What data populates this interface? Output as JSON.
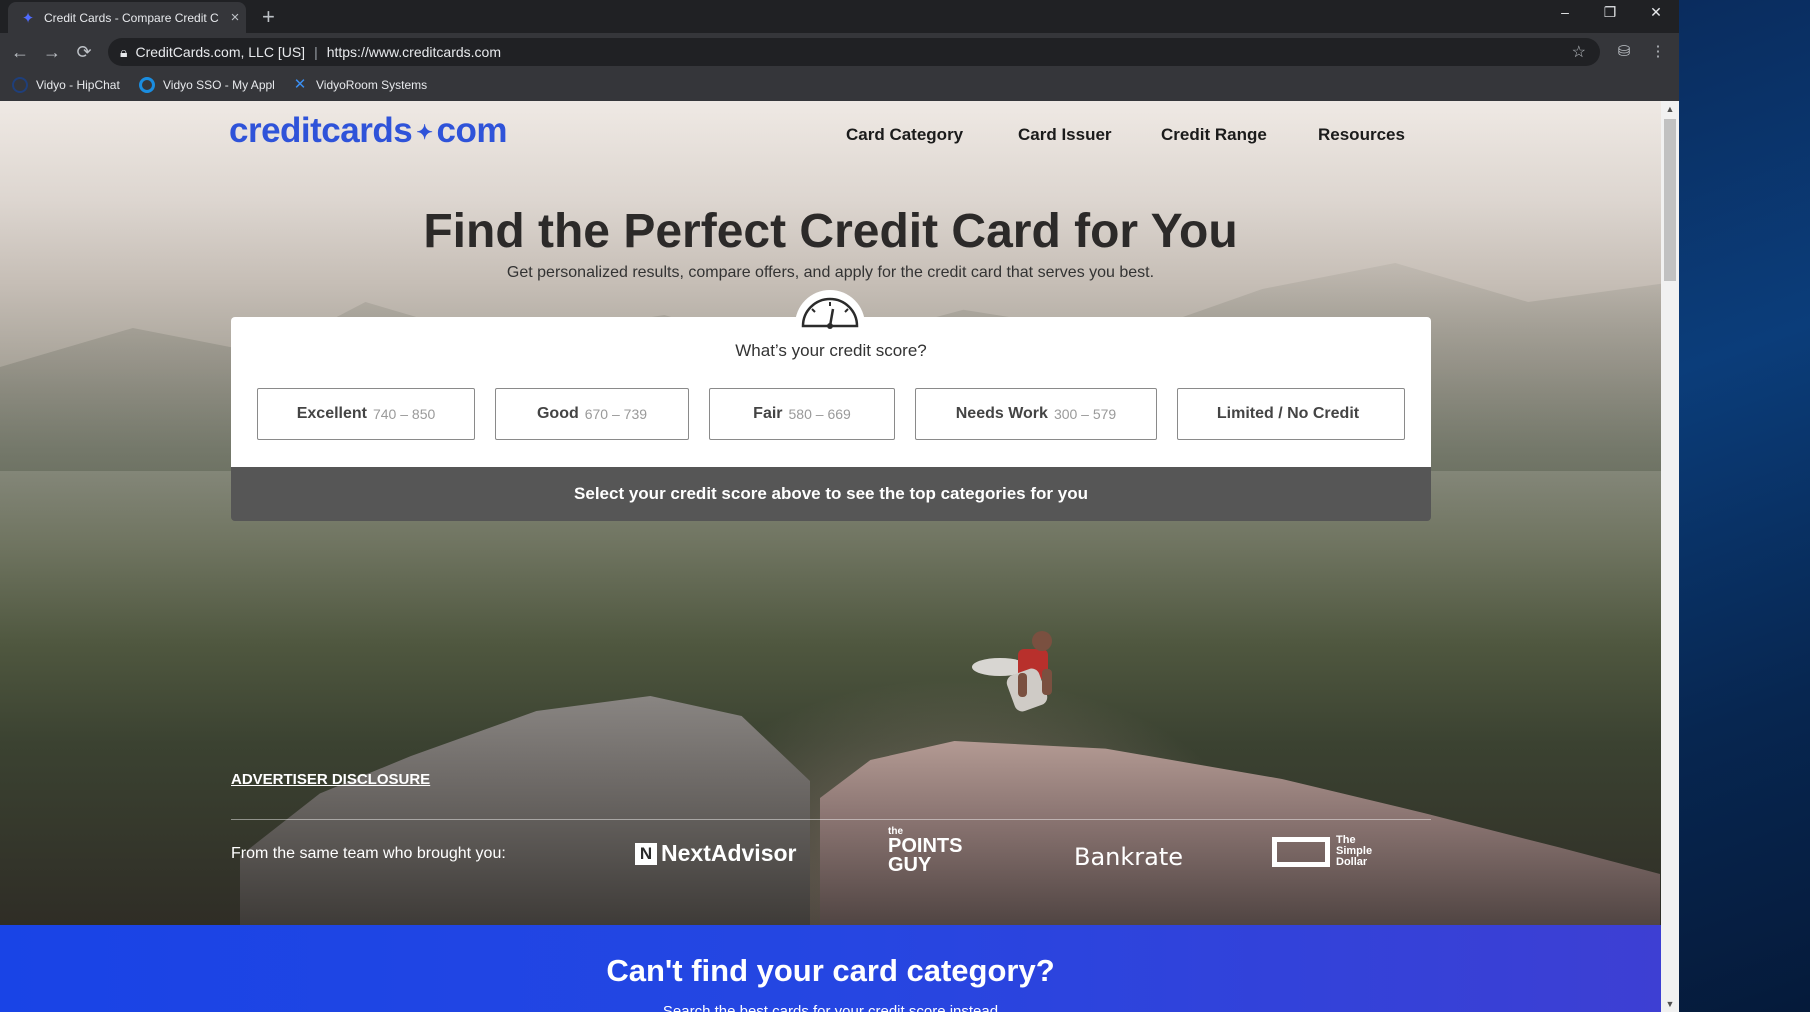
{
  "browser": {
    "tab_title": "Credit Cards - Compare Credit C",
    "new_tab": "+",
    "window_controls": {
      "minimize": "–",
      "restore": "❐",
      "close": "✕"
    },
    "address": {
      "site_identity": "CreditCards.com, LLC [US]",
      "url": "https://www.creditcards.com"
    },
    "bookmarks": [
      {
        "label": "Vidyo - HipChat",
        "icon": "hipchat-icon"
      },
      {
        "label": "Vidyo SSO - My Appl",
        "icon": "sso-icon"
      },
      {
        "label": "VidyoRoom Systems",
        "icon": "vidyo-icon"
      }
    ]
  },
  "site": {
    "logo_left": "creditcards",
    "logo_dot": "✦",
    "logo_right": "com",
    "nav": [
      "Card Category",
      "Card Issuer",
      "Credit Range",
      "Resources"
    ]
  },
  "hero": {
    "title": "Find the Perfect Credit Card for You",
    "subtitle": "Get personalized results, compare offers, and apply for the credit card that serves you best.",
    "score_question": "What’s your credit score?",
    "score_options": [
      {
        "label": "Excellent",
        "range": "740 – 850"
      },
      {
        "label": "Good",
        "range": "670 – 739"
      },
      {
        "label": "Fair",
        "range": "580 – 669"
      },
      {
        "label": "Needs Work",
        "range": "300 – 579"
      },
      {
        "label": "Limited / No Credit",
        "range": ""
      }
    ],
    "score_prompt": "Select your credit score above to see the top categories for you",
    "disclosure": "ADVERTISER DISCLOSURE",
    "from_team": "From the same team who brought you:",
    "partners": {
      "nextadvisor": "NextAdvisor",
      "tpg_small": "the",
      "tpg_line1": "POINTS",
      "tpg_line2": "GUY",
      "bankrate": "Bankrate",
      "simple_line1": "The",
      "simple_line2": "Simple",
      "simple_line3": "Dollar"
    }
  },
  "band": {
    "title": "Can't find your card category?",
    "subtitle": "Search the best cards for your credit score instead"
  },
  "colors": {
    "brand_blue": "#2f53d9",
    "band_blue": "#1944e6",
    "score_bar": "#565656"
  }
}
